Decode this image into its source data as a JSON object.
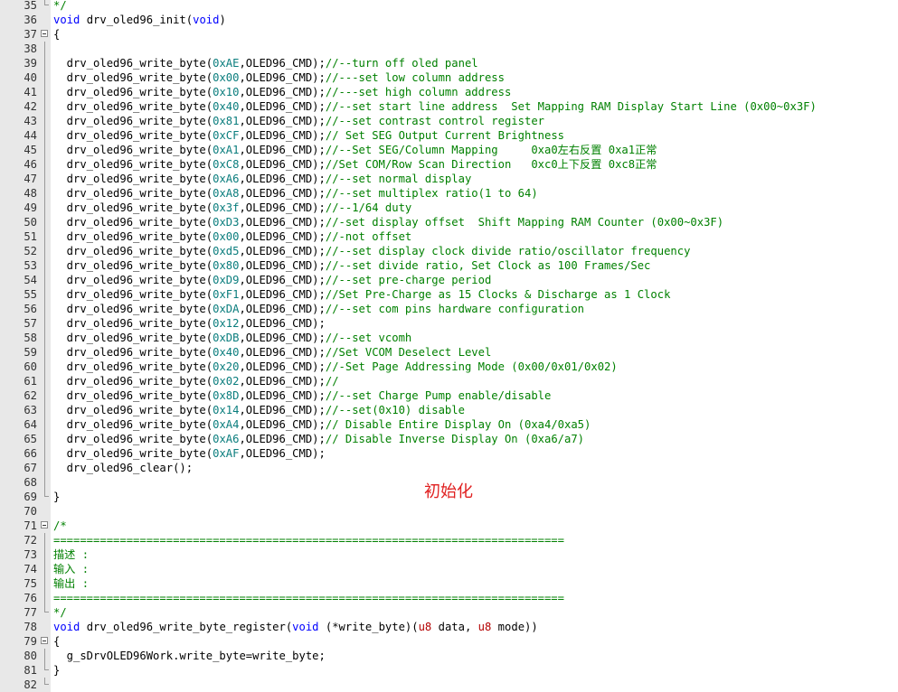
{
  "editor": {
    "lines": [
      {
        "n": "35",
        "fold": "end",
        "tokens": [
          {
            "c": "cmt",
            "t": "*/"
          }
        ]
      },
      {
        "n": "36",
        "fold": "",
        "tokens": [
          {
            "c": "kw",
            "t": "void"
          },
          {
            "c": "",
            "t": " drv_oled96_init("
          },
          {
            "c": "kw",
            "t": "void"
          },
          {
            "c": "",
            "t": ")"
          }
        ]
      },
      {
        "n": "37",
        "fold": "box",
        "tokens": [
          {
            "c": "",
            "t": "{"
          }
        ]
      },
      {
        "n": "38",
        "fold": "line",
        "tokens": []
      },
      {
        "n": "39",
        "fold": "line",
        "tokens": [
          {
            "c": "",
            "t": "  drv_oled96_write_byte("
          },
          {
            "c": "num",
            "t": "0xAE"
          },
          {
            "c": "",
            "t": ",OLED96_CMD);"
          },
          {
            "c": "cmt",
            "t": "//--turn off oled panel"
          }
        ]
      },
      {
        "n": "40",
        "fold": "line",
        "tokens": [
          {
            "c": "",
            "t": "  drv_oled96_write_byte("
          },
          {
            "c": "num",
            "t": "0x00"
          },
          {
            "c": "",
            "t": ",OLED96_CMD);"
          },
          {
            "c": "cmt",
            "t": "//---set low column address"
          }
        ]
      },
      {
        "n": "41",
        "fold": "line",
        "tokens": [
          {
            "c": "",
            "t": "  drv_oled96_write_byte("
          },
          {
            "c": "num",
            "t": "0x10"
          },
          {
            "c": "",
            "t": ",OLED96_CMD);"
          },
          {
            "c": "cmt",
            "t": "//---set high column address"
          }
        ]
      },
      {
        "n": "42",
        "fold": "line",
        "tokens": [
          {
            "c": "",
            "t": "  drv_oled96_write_byte("
          },
          {
            "c": "num",
            "t": "0x40"
          },
          {
            "c": "",
            "t": ",OLED96_CMD);"
          },
          {
            "c": "cmt",
            "t": "//--set start line address  Set Mapping RAM Display Start Line (0x00~0x3F)"
          }
        ]
      },
      {
        "n": "43",
        "fold": "line",
        "tokens": [
          {
            "c": "",
            "t": "  drv_oled96_write_byte("
          },
          {
            "c": "num",
            "t": "0x81"
          },
          {
            "c": "",
            "t": ",OLED96_CMD);"
          },
          {
            "c": "cmt",
            "t": "//--set contrast control register"
          }
        ]
      },
      {
        "n": "44",
        "fold": "line",
        "tokens": [
          {
            "c": "",
            "t": "  drv_oled96_write_byte("
          },
          {
            "c": "num",
            "t": "0xCF"
          },
          {
            "c": "",
            "t": ",OLED96_CMD);"
          },
          {
            "c": "cmt",
            "t": "// Set SEG Output Current Brightness"
          }
        ]
      },
      {
        "n": "45",
        "fold": "line",
        "tokens": [
          {
            "c": "",
            "t": "  drv_oled96_write_byte("
          },
          {
            "c": "num",
            "t": "0xA1"
          },
          {
            "c": "",
            "t": ",OLED96_CMD);"
          },
          {
            "c": "cmt",
            "t": "//--Set SEG/Column Mapping     0xa0"
          },
          {
            "c": "cmt cjk",
            "t": "左右反置"
          },
          {
            "c": "cmt",
            "t": " 0xa1"
          },
          {
            "c": "cmt cjk",
            "t": "正常"
          }
        ]
      },
      {
        "n": "46",
        "fold": "line",
        "tokens": [
          {
            "c": "",
            "t": "  drv_oled96_write_byte("
          },
          {
            "c": "num",
            "t": "0xC8"
          },
          {
            "c": "",
            "t": ",OLED96_CMD);"
          },
          {
            "c": "cmt",
            "t": "//Set COM/Row Scan Direction   0xc0"
          },
          {
            "c": "cmt cjk",
            "t": "上下反置"
          },
          {
            "c": "cmt",
            "t": " 0xc8"
          },
          {
            "c": "cmt cjk",
            "t": "正常"
          }
        ]
      },
      {
        "n": "47",
        "fold": "line",
        "tokens": [
          {
            "c": "",
            "t": "  drv_oled96_write_byte("
          },
          {
            "c": "num",
            "t": "0xA6"
          },
          {
            "c": "",
            "t": ",OLED96_CMD);"
          },
          {
            "c": "cmt",
            "t": "//--set normal display"
          }
        ]
      },
      {
        "n": "48",
        "fold": "line",
        "tokens": [
          {
            "c": "",
            "t": "  drv_oled96_write_byte("
          },
          {
            "c": "num",
            "t": "0xA8"
          },
          {
            "c": "",
            "t": ",OLED96_CMD);"
          },
          {
            "c": "cmt",
            "t": "//--set multiplex ratio(1 to 64)"
          }
        ]
      },
      {
        "n": "49",
        "fold": "line",
        "tokens": [
          {
            "c": "",
            "t": "  drv_oled96_write_byte("
          },
          {
            "c": "num",
            "t": "0x3f"
          },
          {
            "c": "",
            "t": ",OLED96_CMD);"
          },
          {
            "c": "cmt",
            "t": "//--1/64 duty"
          }
        ]
      },
      {
        "n": "50",
        "fold": "line",
        "tokens": [
          {
            "c": "",
            "t": "  drv_oled96_write_byte("
          },
          {
            "c": "num",
            "t": "0xD3"
          },
          {
            "c": "",
            "t": ",OLED96_CMD);"
          },
          {
            "c": "cmt",
            "t": "//-set display offset  Shift Mapping RAM Counter (0x00~0x3F)"
          }
        ]
      },
      {
        "n": "51",
        "fold": "line",
        "tokens": [
          {
            "c": "",
            "t": "  drv_oled96_write_byte("
          },
          {
            "c": "num",
            "t": "0x00"
          },
          {
            "c": "",
            "t": ",OLED96_CMD);"
          },
          {
            "c": "cmt",
            "t": "//-not offset"
          }
        ]
      },
      {
        "n": "52",
        "fold": "line",
        "tokens": [
          {
            "c": "",
            "t": "  drv_oled96_write_byte("
          },
          {
            "c": "num",
            "t": "0xd5"
          },
          {
            "c": "",
            "t": ",OLED96_CMD);"
          },
          {
            "c": "cmt",
            "t": "//--set display clock divide ratio/oscillator frequency"
          }
        ]
      },
      {
        "n": "53",
        "fold": "line",
        "tokens": [
          {
            "c": "",
            "t": "  drv_oled96_write_byte("
          },
          {
            "c": "num",
            "t": "0x80"
          },
          {
            "c": "",
            "t": ",OLED96_CMD);"
          },
          {
            "c": "cmt",
            "t": "//--set divide ratio, Set Clock as 100 Frames/Sec"
          }
        ]
      },
      {
        "n": "54",
        "fold": "line",
        "tokens": [
          {
            "c": "",
            "t": "  drv_oled96_write_byte("
          },
          {
            "c": "num",
            "t": "0xD9"
          },
          {
            "c": "",
            "t": ",OLED96_CMD);"
          },
          {
            "c": "cmt",
            "t": "//--set pre-charge period"
          }
        ]
      },
      {
        "n": "55",
        "fold": "line",
        "tokens": [
          {
            "c": "",
            "t": "  drv_oled96_write_byte("
          },
          {
            "c": "num",
            "t": "0xF1"
          },
          {
            "c": "",
            "t": ",OLED96_CMD);"
          },
          {
            "c": "cmt",
            "t": "//Set Pre-Charge as 15 Clocks & Discharge as 1 Clock"
          }
        ]
      },
      {
        "n": "56",
        "fold": "line",
        "tokens": [
          {
            "c": "",
            "t": "  drv_oled96_write_byte("
          },
          {
            "c": "num",
            "t": "0xDA"
          },
          {
            "c": "",
            "t": ",OLED96_CMD);"
          },
          {
            "c": "cmt",
            "t": "//--set com pins hardware configuration"
          }
        ]
      },
      {
        "n": "57",
        "fold": "line",
        "tokens": [
          {
            "c": "",
            "t": "  drv_oled96_write_byte("
          },
          {
            "c": "num",
            "t": "0x12"
          },
          {
            "c": "",
            "t": ",OLED96_CMD);"
          }
        ]
      },
      {
        "n": "58",
        "fold": "line",
        "tokens": [
          {
            "c": "",
            "t": "  drv_oled96_write_byte("
          },
          {
            "c": "num",
            "t": "0xDB"
          },
          {
            "c": "",
            "t": ",OLED96_CMD);"
          },
          {
            "c": "cmt",
            "t": "//--set vcomh"
          }
        ]
      },
      {
        "n": "59",
        "fold": "line",
        "tokens": [
          {
            "c": "",
            "t": "  drv_oled96_write_byte("
          },
          {
            "c": "num",
            "t": "0x40"
          },
          {
            "c": "",
            "t": ",OLED96_CMD);"
          },
          {
            "c": "cmt",
            "t": "//Set VCOM Deselect Level"
          }
        ]
      },
      {
        "n": "60",
        "fold": "line",
        "tokens": [
          {
            "c": "",
            "t": "  drv_oled96_write_byte("
          },
          {
            "c": "num",
            "t": "0x20"
          },
          {
            "c": "",
            "t": ",OLED96_CMD);"
          },
          {
            "c": "cmt",
            "t": "//-Set Page Addressing Mode (0x00/0x01/0x02)"
          }
        ]
      },
      {
        "n": "61",
        "fold": "line",
        "tokens": [
          {
            "c": "",
            "t": "  drv_oled96_write_byte("
          },
          {
            "c": "num",
            "t": "0x02"
          },
          {
            "c": "",
            "t": ",OLED96_CMD);"
          },
          {
            "c": "cmt",
            "t": "//"
          }
        ]
      },
      {
        "n": "62",
        "fold": "line",
        "tokens": [
          {
            "c": "",
            "t": "  drv_oled96_write_byte("
          },
          {
            "c": "num",
            "t": "0x8D"
          },
          {
            "c": "",
            "t": ",OLED96_CMD);"
          },
          {
            "c": "cmt",
            "t": "//--set Charge Pump enable/disable"
          }
        ]
      },
      {
        "n": "63",
        "fold": "line",
        "tokens": [
          {
            "c": "",
            "t": "  drv_oled96_write_byte("
          },
          {
            "c": "num",
            "t": "0x14"
          },
          {
            "c": "",
            "t": ",OLED96_CMD);"
          },
          {
            "c": "cmt",
            "t": "//--set(0x10) disable"
          }
        ]
      },
      {
        "n": "64",
        "fold": "line",
        "tokens": [
          {
            "c": "",
            "t": "  drv_oled96_write_byte("
          },
          {
            "c": "num",
            "t": "0xA4"
          },
          {
            "c": "",
            "t": ",OLED96_CMD);"
          },
          {
            "c": "cmt",
            "t": "// Disable Entire Display On (0xa4/0xa5)"
          }
        ]
      },
      {
        "n": "65",
        "fold": "line",
        "tokens": [
          {
            "c": "",
            "t": "  drv_oled96_write_byte("
          },
          {
            "c": "num",
            "t": "0xA6"
          },
          {
            "c": "",
            "t": ",OLED96_CMD);"
          },
          {
            "c": "cmt",
            "t": "// Disable Inverse Display On (0xa6/a7)"
          }
        ]
      },
      {
        "n": "66",
        "fold": "line",
        "tokens": [
          {
            "c": "",
            "t": "  drv_oled96_write_byte("
          },
          {
            "c": "num",
            "t": "0xAF"
          },
          {
            "c": "",
            "t": ",OLED96_CMD);"
          }
        ]
      },
      {
        "n": "67",
        "fold": "line",
        "tokens": [
          {
            "c": "",
            "t": "  drv_oled96_clear();"
          }
        ]
      },
      {
        "n": "68",
        "fold": "line",
        "tokens": []
      },
      {
        "n": "69",
        "fold": "end",
        "tokens": [
          {
            "c": "",
            "t": "}"
          }
        ]
      },
      {
        "n": "70",
        "fold": "",
        "tokens": []
      },
      {
        "n": "71",
        "fold": "box",
        "tokens": [
          {
            "c": "cmt",
            "t": "/*"
          }
        ]
      },
      {
        "n": "72",
        "fold": "line",
        "tokens": [
          {
            "c": "cmt",
            "t": "============================================================================="
          }
        ]
      },
      {
        "n": "73",
        "fold": "line",
        "tokens": [
          {
            "c": "cmt cjk",
            "t": "描述"
          },
          {
            "c": "cmt",
            "t": " :"
          }
        ]
      },
      {
        "n": "74",
        "fold": "line",
        "tokens": [
          {
            "c": "cmt cjk",
            "t": "输入"
          },
          {
            "c": "cmt",
            "t": " :"
          }
        ]
      },
      {
        "n": "75",
        "fold": "line",
        "tokens": [
          {
            "c": "cmt cjk",
            "t": "输出"
          },
          {
            "c": "cmt",
            "t": " :"
          }
        ]
      },
      {
        "n": "76",
        "fold": "line",
        "tokens": [
          {
            "c": "cmt",
            "t": "============================================================================="
          }
        ]
      },
      {
        "n": "77",
        "fold": "end",
        "tokens": [
          {
            "c": "cmt",
            "t": "*/"
          }
        ]
      },
      {
        "n": "78",
        "fold": "",
        "tokens": [
          {
            "c": "kw",
            "t": "void"
          },
          {
            "c": "",
            "t": " drv_oled96_write_byte_register("
          },
          {
            "c": "kw",
            "t": "void"
          },
          {
            "c": "",
            "t": " (*write_byte)("
          },
          {
            "c": "type",
            "t": "u8"
          },
          {
            "c": "",
            "t": " data, "
          },
          {
            "c": "type",
            "t": "u8"
          },
          {
            "c": "",
            "t": " mode))"
          }
        ]
      },
      {
        "n": "79",
        "fold": "box",
        "tokens": [
          {
            "c": "",
            "t": "{"
          }
        ]
      },
      {
        "n": "80",
        "fold": "line",
        "tokens": [
          {
            "c": "",
            "t": "  g_sDrvOLED96Work.write_byte=write_byte;"
          }
        ]
      },
      {
        "n": "81",
        "fold": "end",
        "tokens": [
          {
            "c": "",
            "t": "}"
          }
        ]
      },
      {
        "n": "82",
        "fold": "end",
        "tokens": []
      }
    ]
  },
  "annotation": {
    "text": "初始化",
    "color": "#e02020"
  },
  "colors": {
    "keyword": "#0000ff",
    "number": "#0a7d7d",
    "comment": "#008000",
    "type": "#b40000",
    "gutter": "#e8e8e8"
  }
}
